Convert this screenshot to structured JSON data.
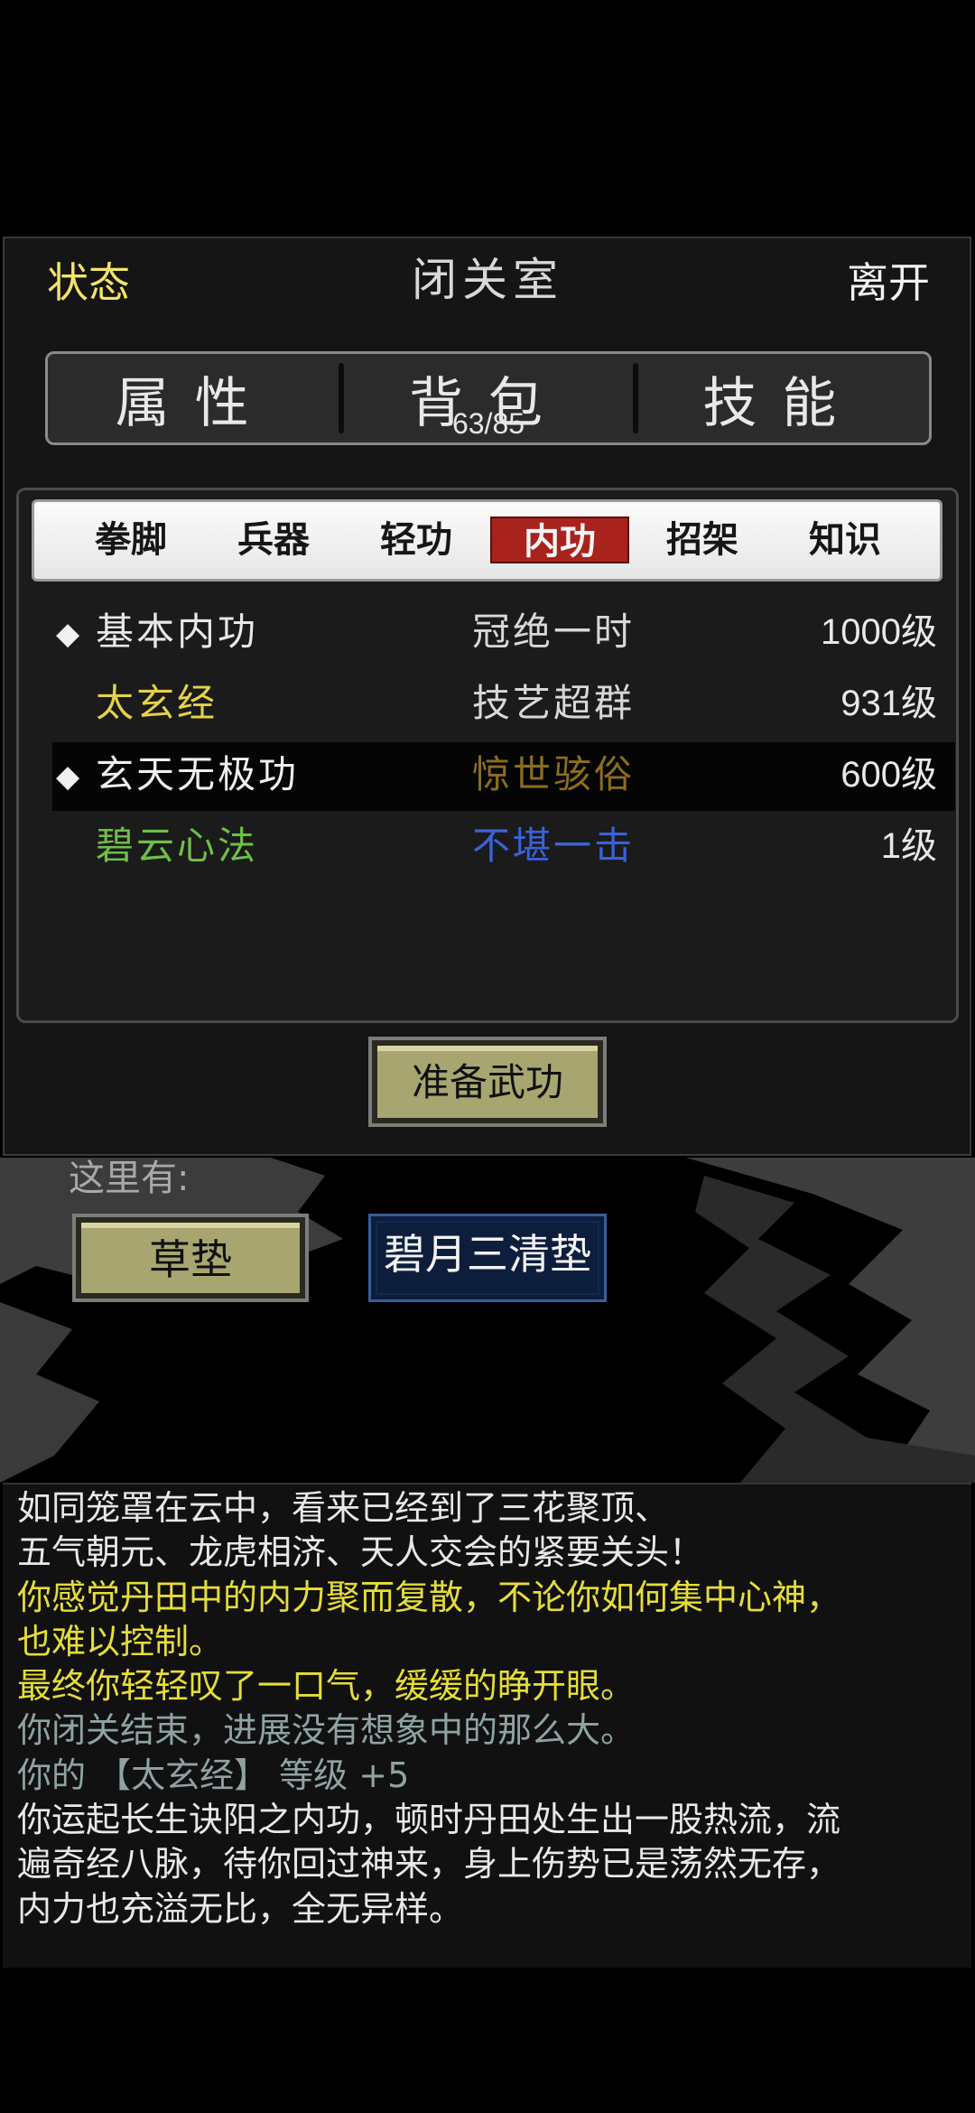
{
  "header": {
    "status_label": "状态",
    "title": "闭关室",
    "leave_label": "离开"
  },
  "main_tabs": [
    {
      "label": "属性"
    },
    {
      "label": "背包",
      "count": "63/85"
    },
    {
      "label": "技能"
    }
  ],
  "sub_tabs": [
    "拳脚",
    "兵器",
    "轻功",
    "内功",
    "招架",
    "知识"
  ],
  "active_sub_tab": "内功",
  "skills": [
    {
      "name": "基本内功",
      "grade": "冠绝一时",
      "level": "1000级",
      "equipped": true,
      "name_color": "#e8e8e8",
      "grade_color": "#d8d8d8"
    },
    {
      "name": "太玄经",
      "grade": "技艺超群",
      "level": "931级",
      "equipped": false,
      "name_color": "#e6d24a",
      "grade_color": "#d8d8d8"
    },
    {
      "name": "玄天无极功",
      "grade": "惊世骇俗",
      "level": "600级",
      "equipped": true,
      "name_color": "#f0f0f0",
      "grade_color": "#8a6d1e",
      "selected": true
    },
    {
      "name": "碧云心法",
      "grade": "不堪一击",
      "level": "1级",
      "equipped": false,
      "name_color": "#6fbf4a",
      "grade_color": "#3a62d8"
    }
  ],
  "prepare_button": "准备武功",
  "scene": {
    "here_label": "这里有:",
    "items": [
      {
        "label": "草垫",
        "rarity": "common"
      },
      {
        "label": "碧月三清垫",
        "rarity": "rare"
      }
    ]
  },
  "log": [
    {
      "text": "如同笼罩在云中，看来已经到了三花聚顶、",
      "color": "#e8e8e8"
    },
    {
      "text": "五气朝元、龙虎相济、天人交会的紧要关头！",
      "color": "#e8e8e8"
    },
    {
      "text": "你感觉丹田中的内力聚而复散，不论你如何集中心神，",
      "color": "#e6dd3a"
    },
    {
      "text": "也难以控制。",
      "color": "#e6dd3a"
    },
    {
      "text": "最终你轻轻叹了一口气，缓缓的睁开眼。",
      "color": "#e6dd3a"
    },
    {
      "text": "你闭关结束，进展没有想象中的那么大。",
      "color": "#8fa3a3"
    },
    {
      "text": "你的 【太玄经】 等级 +5",
      "color": "#8fa3a3"
    },
    {
      "text": "你运起长生诀阳之内功，顿时丹田处生出一股热流，流",
      "color": "#e8e8e8"
    },
    {
      "text": "遍奇经八脉，待你回过神来，身上伤势已是荡然无存，",
      "color": "#e8e8e8"
    },
    {
      "text": "内力也充溢无比，全无异样。",
      "color": "#e8e8e8"
    }
  ],
  "colors": {
    "panel_bg": "#151515",
    "active_tab": "#a8231d",
    "button_face": "#a7a671"
  }
}
